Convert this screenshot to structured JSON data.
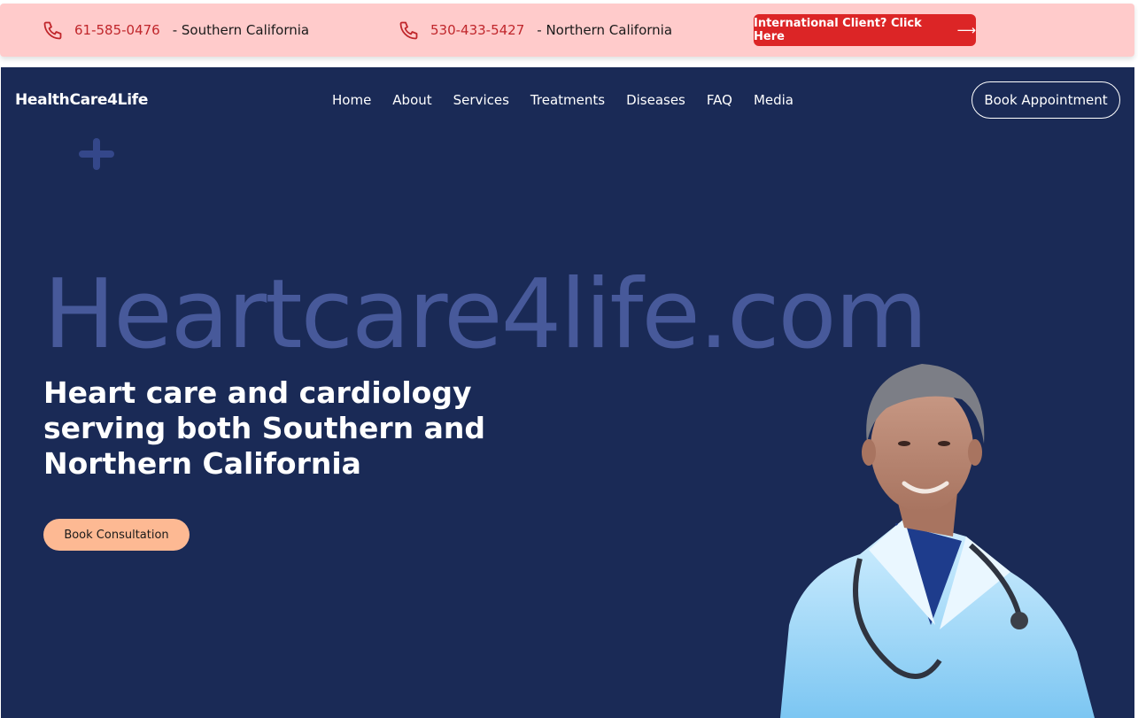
{
  "topbar": {
    "south": {
      "number": "61-585-0476",
      "region": "- Southern California",
      "icon": "phone-icon"
    },
    "north": {
      "number": "530-433-5427",
      "region": "- Northern California",
      "icon": "phone-icon"
    },
    "intl_button": {
      "label": "International Client? Click Here",
      "arrow": "⟶"
    }
  },
  "header": {
    "brand": "HealthCare4Life",
    "nav": [
      "Home",
      "About",
      "Services",
      "Treatments",
      "Diseases",
      "FAQ",
      "Media"
    ],
    "cta": "Book Appointment"
  },
  "hero": {
    "watermark": "Heartcare4life.com",
    "headline": "Heart care and cardiology serving both Southern and Northern California",
    "cta": "Book Consultation"
  },
  "colors": {
    "topbar_bg": "#ffcbcb",
    "accent_red": "#dc2526",
    "hero_bg": "#1a2a56",
    "watermark": "#47599a",
    "consult_btn": "#fdb993"
  }
}
